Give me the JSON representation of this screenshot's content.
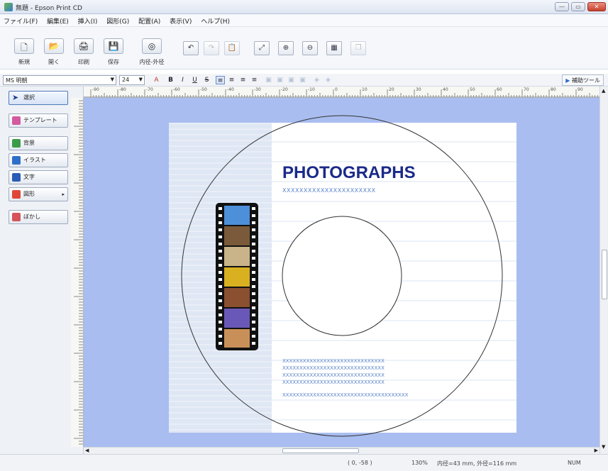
{
  "window": {
    "title": "無題 - Epson Print CD",
    "minimize": "—",
    "maximize": "▭",
    "close": "✕"
  },
  "menu": [
    "ファイル(F)",
    "編集(E)",
    "挿入(I)",
    "図形(G)",
    "配置(A)",
    "表示(V)",
    "ヘルプ(H)"
  ],
  "toolbar": {
    "buttons": [
      {
        "label": "新規",
        "icon": "new-document-icon",
        "glyph": "🗋"
      },
      {
        "label": "開く",
        "icon": "open-folder-icon",
        "glyph": "📂"
      },
      {
        "label": "印刷",
        "icon": "print-icon",
        "glyph": "🖨"
      },
      {
        "label": "保存",
        "icon": "save-icon",
        "glyph": "💾"
      },
      {
        "label": "内径-外径",
        "icon": "inner-outer-diameter-icon",
        "glyph": "◎"
      }
    ],
    "edit_tools": [
      {
        "icon": "undo-icon",
        "glyph": "↶"
      },
      {
        "icon": "redo-icon",
        "glyph": "↷"
      },
      {
        "icon": "paste-icon",
        "glyph": "📋"
      },
      {
        "icon": "fit-page-icon",
        "glyph": "⤢"
      },
      {
        "icon": "zoom-in-icon",
        "glyph": "⊕"
      },
      {
        "icon": "zoom-out-icon",
        "glyph": "⊖"
      },
      {
        "icon": "grid-icon",
        "glyph": "▦"
      },
      {
        "icon": "layers-icon",
        "glyph": "❐"
      }
    ]
  },
  "format_bar": {
    "font_name": "MS 明朝",
    "font_size": "24",
    "assist_tool": "補助ツール",
    "buttons": [
      "A",
      "B",
      "I",
      "U",
      "S",
      "≡",
      "≡",
      "≡",
      "≡"
    ]
  },
  "sidebar": [
    {
      "label": "選択",
      "icon": "cursor-icon",
      "color": "#3a64c8"
    },
    {
      "label": "テンプレート",
      "icon": "template-icon",
      "color": "#d45aa0"
    },
    {
      "label": "背景",
      "icon": "background-icon",
      "color": "#3c9b4a"
    },
    {
      "label": "イラスト",
      "icon": "illustration-icon",
      "color": "#2e6fc9"
    },
    {
      "label": "文字",
      "icon": "text-icon",
      "color": "#2a5bb5"
    },
    {
      "label": "図形",
      "icon": "shape-icon",
      "color": "#e0453a"
    },
    {
      "label": "ぼかし",
      "icon": "blur-icon",
      "color": "#d4545a"
    }
  ],
  "ruler": {
    "top_labels": [
      "-90",
      "-80",
      "-70",
      "-60",
      "-50",
      "-40",
      "-30",
      "-20",
      "-10",
      "0",
      "10",
      "20",
      "30",
      "40",
      "50",
      "60",
      "70",
      "80",
      "90"
    ]
  },
  "disc": {
    "title": "PHOTOGRAPHS",
    "subtitle": "XXXXXXXXXXXXXXXXXXXXXX",
    "text_lines": [
      "XXXXXXXXXXXXXXXXXXXXXXXXXXXXXX",
      "XXXXXXXXXXXXXXXXXXXXXXXXXXXXXX",
      "XXXXXXXXXXXXXXXXXXXXXXXXXXXXXX",
      "XXXXXXXXXXXXXXXXXXXXXXXXXXXXXX",
      "XXXXXXXXXXXXXXXXXXXXXXXXXXXXXXXXXXXXX"
    ],
    "title_color": "#1b2a8a",
    "x_color": "#5a84c8"
  },
  "status": {
    "coords": "( 0, -58 )",
    "zoom": "130%",
    "diameters": "内径=43 mm, 外径=116 mm",
    "mode": "NUM"
  }
}
